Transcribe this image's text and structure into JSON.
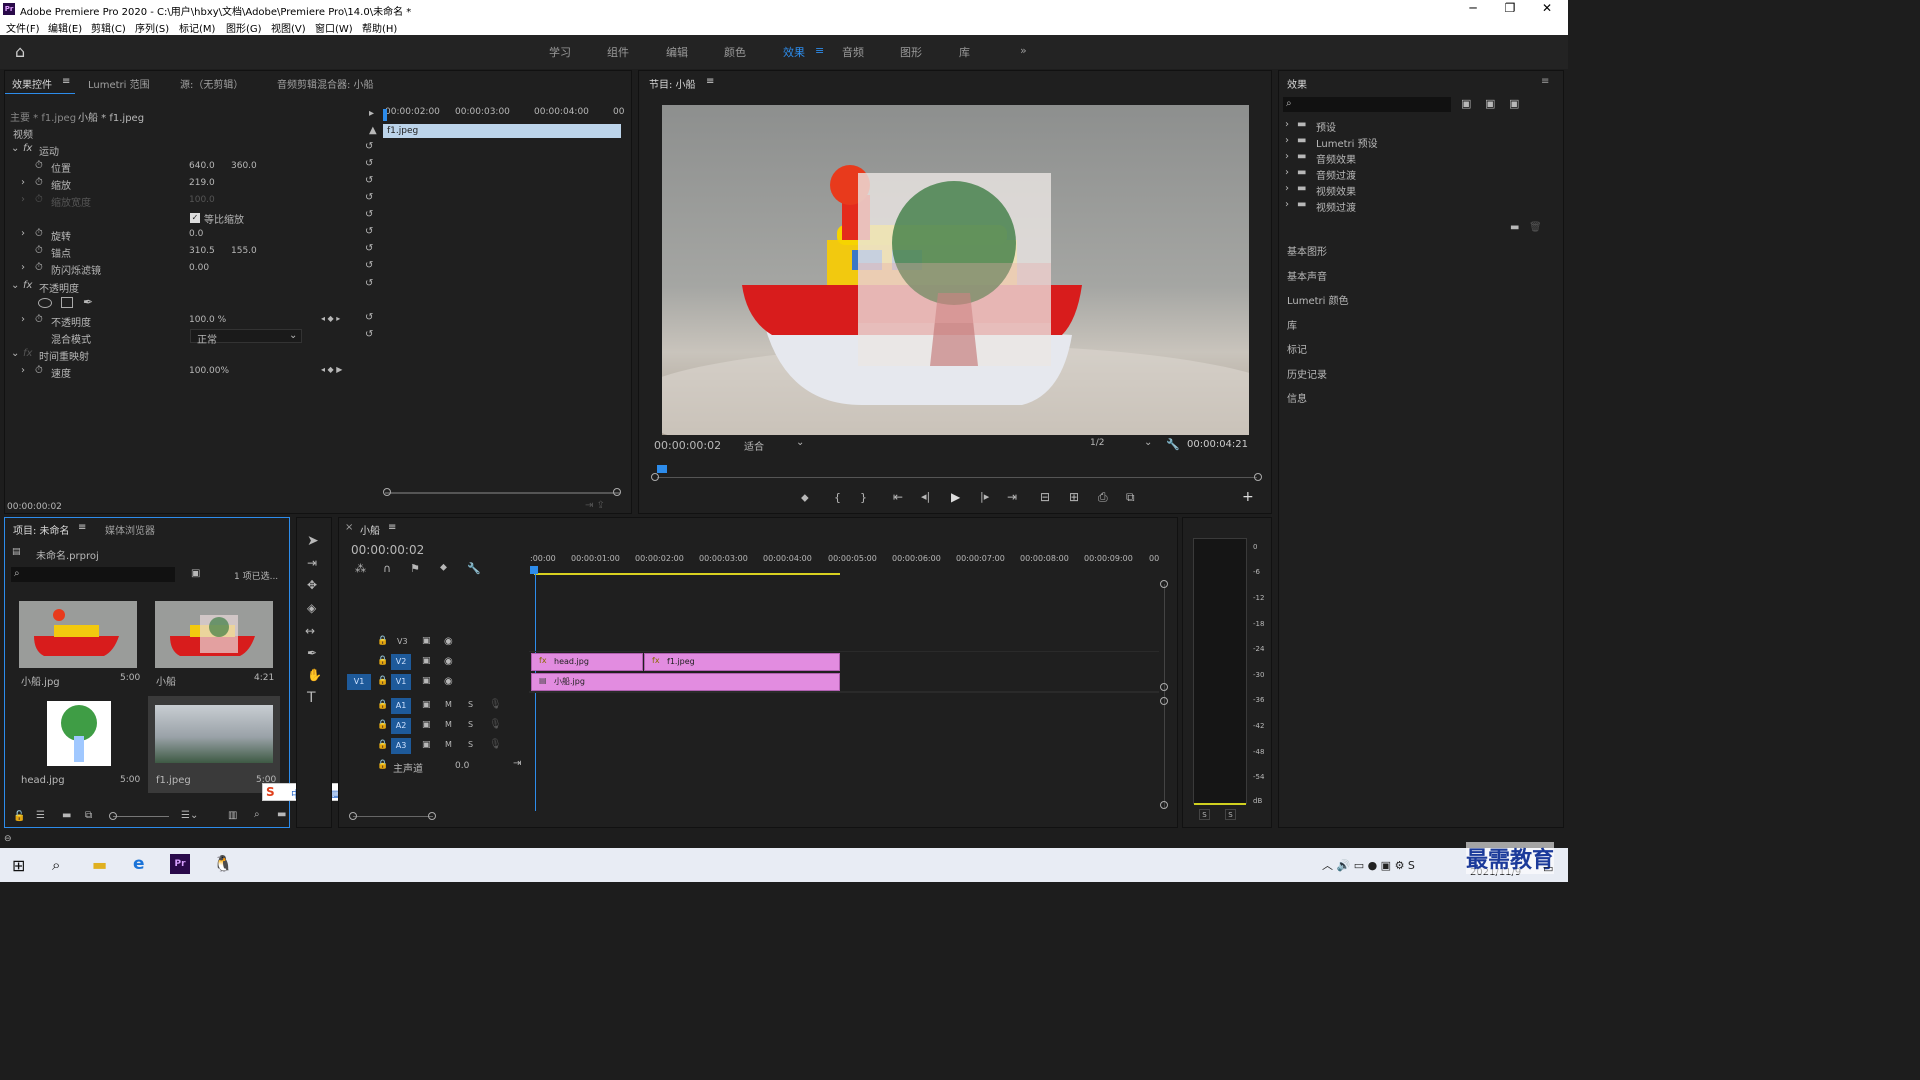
{
  "window": {
    "title": "Adobe Premiere Pro 2020 - C:\\用户\\hbxy\\文档\\Adobe\\Premiere Pro\\14.0\\未命名 *",
    "logo": "Pr"
  },
  "menu": [
    "文件(F)",
    "编辑(E)",
    "剪辑(C)",
    "序列(S)",
    "标记(M)",
    "图形(G)",
    "视图(V)",
    "窗口(W)",
    "帮助(H)"
  ],
  "workspaces": [
    "学习",
    "组件",
    "编辑",
    "颜色",
    "效果",
    "音频",
    "图形",
    "库"
  ],
  "active_workspace": "效果",
  "effect_controls": {
    "tabs": [
      "效果控件",
      "Lumetri 范围",
      "源:（无剪辑）",
      "音频剪辑混合器: 小船"
    ],
    "master": "主要 * f1.jpeg",
    "clip": "小船 * f1.jpeg",
    "ruler": [
      "00:00:02:00",
      "00:00:03:00",
      "00:00:04:00",
      "00"
    ],
    "clip_bar": "f1.jpeg",
    "section_video": "视频",
    "motion": "运动",
    "position_label": "位置",
    "position_x": "640.0",
    "position_y": "360.0",
    "scale_label": "缩放",
    "scale": "219.0",
    "scale_width_label": "缩放宽度",
    "scale_width": "100.0",
    "uniform_scale": "等比缩放",
    "rotation_label": "旋转",
    "rotation": "0.0",
    "anchor_label": "锚点",
    "anchor_x": "310.5",
    "anchor_y": "155.0",
    "flicker_label": "防闪烁滤镜",
    "flicker": "0.00",
    "opacity_section": "不透明度",
    "opacity_label": "不透明度",
    "opacity": "100.0 %",
    "blend_label": "混合模式",
    "blend": "正常",
    "time_remap": "时间重映射",
    "speed_label": "速度",
    "speed": "100.00%",
    "timecode": "00:00:00:02"
  },
  "program": {
    "title": "节目: 小船",
    "timecode": "00:00:00:02",
    "fit": "适合",
    "resolution": "1/2",
    "duration": "00:00:04:21"
  },
  "effects_panel": {
    "title": "效果",
    "folders": [
      "预设",
      "Lumetri 预设",
      "音频效果",
      "音频过渡",
      "视频效果",
      "视频过渡"
    ],
    "sections": [
      "基本图形",
      "基本声音",
      "Lumetri 颜色",
      "库",
      "标记",
      "历史记录",
      "信息"
    ]
  },
  "project": {
    "tabs": [
      "项目: 未命名",
      "媒体浏览器"
    ],
    "file": "未命名.prproj",
    "selection": "1 项已选...",
    "items": [
      {
        "name": "小船.jpg",
        "duration": "5:00"
      },
      {
        "name": "小船",
        "duration": "4:21"
      },
      {
        "name": "head.jpg",
        "duration": "5:00"
      },
      {
        "name": "f1.jpeg",
        "duration": "5:00"
      }
    ]
  },
  "timeline": {
    "tab": "小船",
    "timecode": "00:00:00:02",
    "ruler": [
      ":00:00",
      "00:00:01:00",
      "00:00:02:00",
      "00:00:03:00",
      "00:00:04:00",
      "00:00:05:00",
      "00:00:06:00",
      "00:00:07:00",
      "00:00:08:00",
      "00:00:09:00",
      "00"
    ],
    "video_tracks": [
      "V3",
      "V2",
      "V1"
    ],
    "source_patch": "V1",
    "audio_tracks": [
      "A1",
      "A2",
      "A3"
    ],
    "master": "主声道",
    "master_value": "0.0",
    "clips": {
      "v2a": "head.jpg",
      "v2b": "f1.jpeg",
      "v1": "小船.jpg"
    }
  },
  "meter": {
    "scale": [
      "0",
      "-6",
      "-12",
      "-18",
      "-24",
      "-30",
      "-36",
      "-42",
      "-48",
      "-54",
      "dB"
    ],
    "solo": [
      "S",
      "S"
    ]
  },
  "taskbar": {
    "date": "2021/11/9",
    "watermark": "最需教育"
  },
  "colors": {
    "accent": "#2d8ceb",
    "clip": "#e28ce0",
    "panel": "#1f1f1f"
  }
}
